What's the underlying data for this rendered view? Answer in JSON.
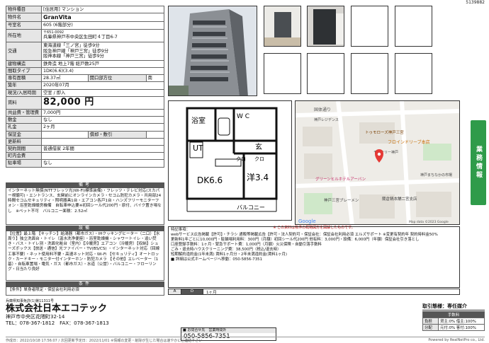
{
  "doc_number": "5139882",
  "property": {
    "type_label": "物件種目",
    "type_value": "[住居用] マンション",
    "name_label": "物件名",
    "name_value": "GranVita",
    "room_label": "号室名",
    "room_value": "605 (6階部分)",
    "location_label": "所在地",
    "zip": "〒651-0092",
    "address": "兵庫県神戸市中央区生田町４丁目6-7",
    "access_label": "交通",
    "access": [
      "東海道線「三ノ宮」徒歩9分",
      "阪急神戸線「神戸三宮」徒歩9分",
      "阪神本線「神戸三宮」徒歩9分"
    ],
    "structure_label": "建物構造",
    "structure_value": "鉄骨造 地上7階 総戸数25戸",
    "layout_label": "間取タイプ",
    "layout_value": "1DK(6.6)(3.4)",
    "area_label": "専有面積",
    "area_value": "28.37㎡",
    "direction_label": "開口部方位",
    "direction_value": "南",
    "built_label": "築年",
    "built_value": "2020年07月",
    "status_label": "現況/入居時期",
    "status_value": "空室 / 即入",
    "rent_label": "賃料",
    "rent_value": "82,000 円",
    "mgmt_label": "共益費・管理費",
    "mgmt_value": "7,000円",
    "deposit_label": "敷金",
    "deposit_value": "なし",
    "key_label": "礼金",
    "key_value": "2ヶ月",
    "guarantee_label": "保証金",
    "shokyaku_label": "償却・敷引",
    "renewal_label": "更新料",
    "contract_label": "契約期間",
    "contract_value": "普通借家 2年間",
    "insurance_label": "町内会費",
    "parking_label": "駐車場",
    "parking_value": "なし"
  },
  "remarks": {
    "head": "備考",
    "text": "インターネット無償(NTTフレッツ光(Wi-Fi)標準装備)・フレッツ・テレビ対応(スカパー視聴可)・エントランス、玄関前にオンラインカメラ・セコム防犯カメラ・共用部24時間セコムセキュリティ・照明器具1台・エアコン各戸1台・ハンズフリーモニターフォン・浴室乾燥暖房機備　自転車申込要※初回シール代200円・原付、バイク置き場なし　※ペット不可　バルコニー面積：2.52㎡"
  },
  "equipment": {
    "head": "設備",
    "text": "【位置】最上階 【キッチン】給湯器（都市ガス）・IHクッキングヒーター（二口）【水周り】独立洗面台・トイレ（温水洗浄便座）・浴室乾燥機・シャワートイレ・追い焚き・バス・トイレ別・洗面化粧台（室内）【冷暖房】エアコン（冷暖房）【収納】シューズボックス【放送・通信】光ファイバー・TV(BS/CS) ・インターネット対応（回線工事不要）・ネット使用料不要・高速ネット対応・Wi-Fi 【セキュリティ】オートロック・カードキー・モニター付インターホン・防犯カメラ 【その他】エレベーター（1基）・自転車置場・電気・ガス（都市ガス）・水道（公営）・バルコニー・フローリング・日当たり良好"
  },
  "conditions": {
    "head": "条件",
    "text": "【条件】単身者限定・保証会社利用必須"
  },
  "floorplan": {
    "bath": "浴室",
    "wc": "W C",
    "ut": "UT",
    "entrance": "玄",
    "closet1": "クロ",
    "closet2": "クロ",
    "dk": "DK6.6",
    "western": "洋3.4",
    "balcony": "バルコニー"
  },
  "map": {
    "labels": [
      "国体通り",
      "トゥモローズ神戸三宮",
      "フロインドリーブ本店",
      "モンテリー神戸",
      "神戸レジデンス",
      "グリーンヒルホテルアーバン",
      "神戸三宮ブレーメン",
      "蘭倉鍋本舗二宮支店",
      "神戸まちなかの市場",
      "Google",
      "Map data ©2023 Google"
    ],
    "notice": "※ この資料は物件の概略図形を図解したものです。"
  },
  "notes": {
    "head": "特記事項：",
    "lines": [
      "webサービス広告掲載【許可】・チラシ 通販等掲載広告【許可・法人契約可・保証会社：保証会社利用必須 エルズサポート ※変更有契約年 契約時料金50%",
      "更新料1年ごとに10,000円・駐輪場利用料：300円（月額）初回シール代200円 他有料：3,000円・設備：6,000円（年額）保証会社引き落とし",
      "口座登録手数料：1ヶ月・緊急サポート費：1,000円（月額）火災保険・自動引落手数料",
      "ごみ・退去時ハウスクリーニング費：38,500円（税込/退去時）",
      "短期解約違約金(1年未満) 賃料1ヶ月分・2年未満違約金(賃料1ヶ月)",
      "■ 詳細は公式ホームページへ移動：050-5856-7351"
    ],
    "top_notice": "※ お問合せの際は、お問い合わせ時に 物件番号をお伝え下さい"
  },
  "ad": {
    "label": "A",
    "mid": "D",
    "value": "1ヶ月"
  },
  "company": {
    "license": "兵庫県知事免許(1)第11311号",
    "name": "株式会社日本エコテック",
    "address": "神戸市中央区花隈町32-14",
    "tel": "TEL：078-367-1812　FAX：078-367-1813"
  },
  "contact": {
    "head": "■ お問合せ先　営業時間外",
    "phone": "050-5856-7351"
  },
  "fee": {
    "title": "取引態様：専任媒介",
    "head": "手数料",
    "rows": [
      [
        "負担",
        "貸主:0%  借主:100%"
      ],
      [
        "分配",
        "元付:0%  客付:100%"
      ]
    ]
  },
  "footer": {
    "left": "作成日：2022/10/18 17:56:07 / 次回更新予定日：2022/11/01 ※情報の変更・削除が生じた場合は速やかにご連絡下さい",
    "right": "Powered by RealNetPro co., Ltd."
  }
}
